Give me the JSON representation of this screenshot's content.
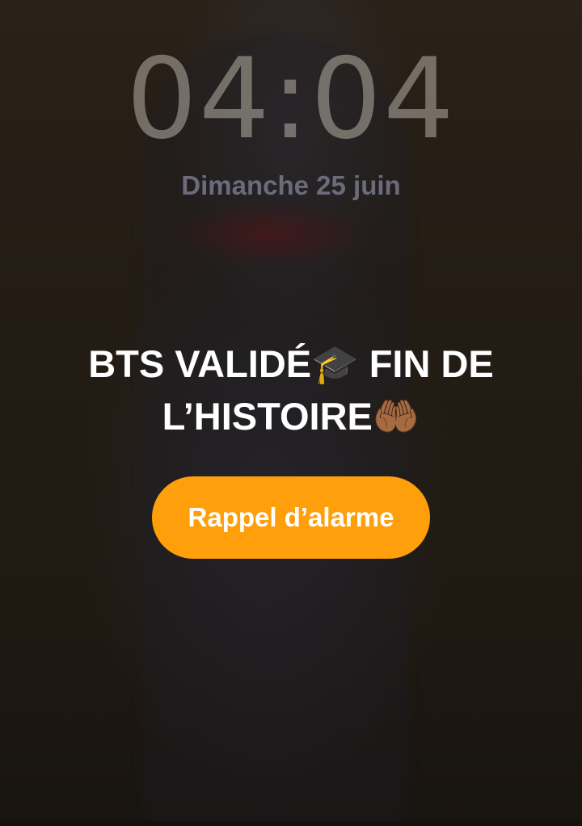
{
  "lock_screen": {
    "time": "04:04",
    "date": "Dimanche 25 juin"
  },
  "alarm": {
    "label": "BTS VALIDÉ🎓 FIN DE L’HISTOIRE🤲🏾",
    "snooze_label": "Rappel d’alarme"
  },
  "colors": {
    "snooze_button": "#fe9f0b",
    "label_text": "#ffffff"
  }
}
